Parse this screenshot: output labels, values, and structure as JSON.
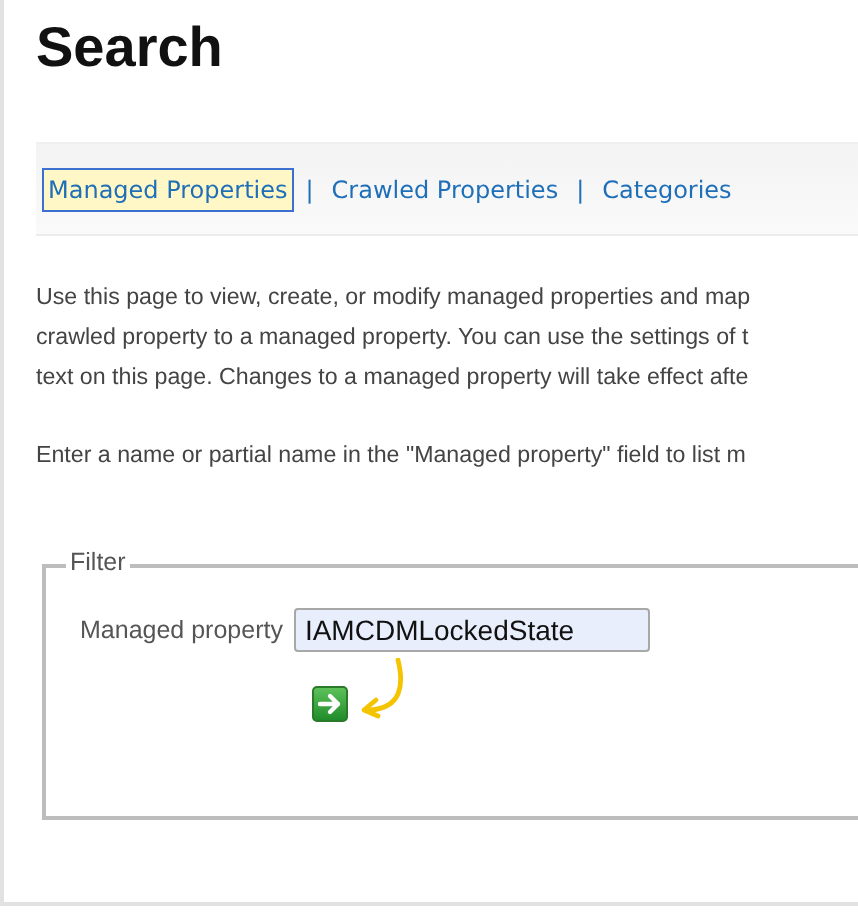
{
  "title": "Search",
  "nav": [
    {
      "label": "Managed Properties",
      "selected": true
    },
    {
      "label": "Crawled Properties",
      "selected": false
    },
    {
      "label": "Categories",
      "selected": false
    }
  ],
  "separator": "|",
  "description": [
    "Use this page to view, create, or modify managed properties and map",
    "crawled property to a managed property. You can use the settings of t",
    "text on this page. Changes to a managed property will take effect afte"
  ],
  "hint": "Enter a name or partial name in the \"Managed property\" field to list m",
  "filter": {
    "legend": "Filter",
    "label": "Managed property",
    "value": "IAMCDMLockedState"
  }
}
